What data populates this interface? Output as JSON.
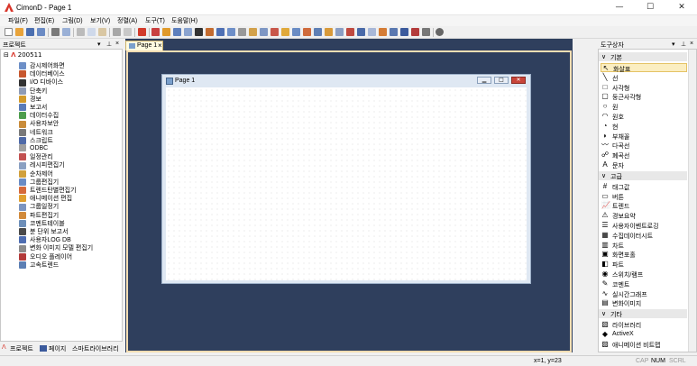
{
  "window": {
    "title": "CimonD - Page 1",
    "minimize": "—",
    "maximize": "☐",
    "close": "✕"
  },
  "menu": [
    "파일(F)",
    "편집(E)",
    "그림(D)",
    "보기(V)",
    "정렬(A)",
    "도구(T)",
    "도움말(H)"
  ],
  "project_panel": {
    "title": "프로젝트",
    "root": "200511",
    "items": [
      {
        "label": "감시제어화면",
        "color": "#6d8fc7"
      },
      {
        "label": "데이터베이스",
        "color": "#c7572e"
      },
      {
        "label": "I/O 디바이스",
        "color": "#333333"
      },
      {
        "label": "단축키",
        "color": "#8e9bb5"
      },
      {
        "label": "경보",
        "color": "#d29a2a"
      },
      {
        "label": "보고서",
        "color": "#5a7bb8"
      },
      {
        "label": "데이터수집",
        "color": "#4d9d4d"
      },
      {
        "label": "사용자보안",
        "color": "#c98c3a"
      },
      {
        "label": "네트워크",
        "color": "#7a7a7a"
      },
      {
        "label": "스크립트",
        "color": "#4f6aa8"
      },
      {
        "label": "ODBC",
        "color": "#a0a0a0"
      },
      {
        "label": "일정관리",
        "color": "#c25151"
      },
      {
        "label": "레시피편집기",
        "color": "#8aa0c2"
      },
      {
        "label": "순차제어",
        "color": "#d1a03c"
      },
      {
        "label": "그룹편집기",
        "color": "#6a8cc4"
      },
      {
        "label": "트렌드탄별편집기",
        "color": "#d66a3a"
      },
      {
        "label": "애니메이션 편집",
        "color": "#e0a030"
      },
      {
        "label": "그룹일정기",
        "color": "#7c95c0"
      },
      {
        "label": "파트편집기",
        "color": "#d18a3b"
      },
      {
        "label": "코멘트테이블",
        "color": "#6e8fb9"
      },
      {
        "label": "분 단위 보고서",
        "color": "#4a4a4a"
      },
      {
        "label": "사용자LOG DB",
        "color": "#4e6db1"
      },
      {
        "label": "변화 이미지 모델 편집기",
        "color": "#8c8c8c"
      },
      {
        "label": "오디오 플레이어",
        "color": "#b23b3b"
      },
      {
        "label": "고속트렌드",
        "color": "#5c7fb4"
      }
    ],
    "tabs": [
      "프로젝트",
      "페이지",
      "스마트라이브러리"
    ]
  },
  "document": {
    "tab_label": "Page 1",
    "tab_close": "×",
    "page_title": "Page 1"
  },
  "toolbox": {
    "title": "도구상자",
    "sections": [
      {
        "name": "기본",
        "items": [
          {
            "label": "화살표",
            "icon": "↖",
            "selected": true
          },
          {
            "label": "선",
            "icon": "╲"
          },
          {
            "label": "사각형",
            "icon": "□"
          },
          {
            "label": "둥근사각형",
            "icon": "▢"
          },
          {
            "label": "원",
            "icon": "○"
          },
          {
            "label": "원호",
            "icon": "◠"
          },
          {
            "label": "현",
            "icon": "◔"
          },
          {
            "label": "부채꼴",
            "icon": "◗"
          },
          {
            "label": "다곡선",
            "icon": "〰"
          },
          {
            "label": "폐곡선",
            "icon": "☍"
          },
          {
            "label": "문자",
            "icon": "A"
          }
        ]
      },
      {
        "name": "고급",
        "items": [
          {
            "label": "태그값",
            "icon": "#"
          },
          {
            "label": "버튼",
            "icon": "▭"
          },
          {
            "label": "트렌드",
            "icon": "📈"
          },
          {
            "label": "경보요약",
            "icon": "⚠"
          },
          {
            "label": "사용자이벤트로깅",
            "icon": "☰"
          },
          {
            "label": "수집데이터시트",
            "icon": "▦"
          },
          {
            "label": "차트",
            "icon": "▥"
          },
          {
            "label": "화면포홀",
            "icon": "▣"
          },
          {
            "label": "파트",
            "icon": "◧"
          },
          {
            "label": "스위치/램프",
            "icon": "◉"
          },
          {
            "label": "코멘트",
            "icon": "✎"
          },
          {
            "label": "실시간그래프",
            "icon": "∿"
          },
          {
            "label": "변화이미지",
            "icon": "▤"
          }
        ]
      },
      {
        "name": "기타",
        "items": [
          {
            "label": "라이브러리",
            "icon": "▧"
          },
          {
            "label": "ActiveX",
            "icon": "◆"
          },
          {
            "label": "애니메이션 비트맵",
            "icon": "▨"
          }
        ]
      }
    ]
  },
  "status": {
    "coords": "x=1, y=23",
    "cap": "CAP",
    "num": "NUM",
    "scrl": "SCRL"
  }
}
